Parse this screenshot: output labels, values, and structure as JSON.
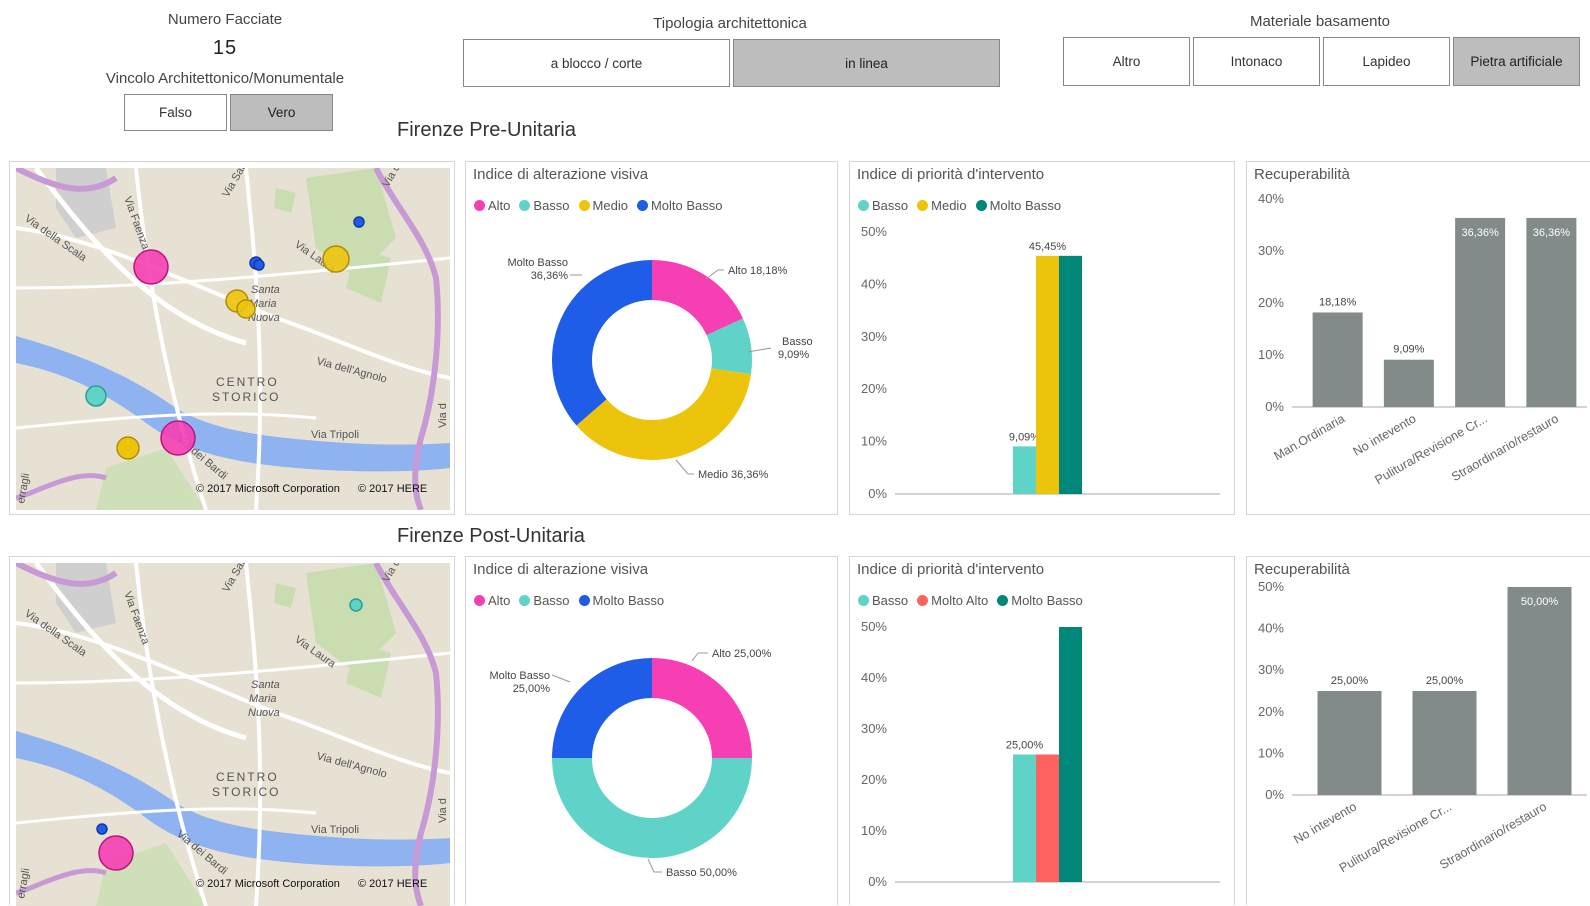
{
  "slicers": {
    "numero_facciate": {
      "title": "Numero Facciate",
      "value": "15"
    },
    "vincolo": {
      "title": "Vincolo Architettonico/Monumentale",
      "options": [
        "Falso",
        "Vero"
      ],
      "selected": "Vero"
    },
    "tipologia": {
      "title": "Tipologia architettonica",
      "options": [
        "a blocco / corte",
        "in linea"
      ],
      "selected": "in linea"
    },
    "materiale": {
      "title": "Materiale basamento",
      "options": [
        "Altro",
        "Intonaco",
        "Lapideo",
        "Pietra artificiale"
      ],
      "selected": "Pietra artificiale"
    }
  },
  "colors": {
    "Alto": "#f53fb3",
    "Basso": "#5fd3c8",
    "Medio": "#edc40c",
    "Molto Basso": "#1f5ce8",
    "Molto Alto": "#fd625e",
    "Molto Basso Priority": "#01877a",
    "gray": "#828b8a"
  },
  "sections": [
    {
      "title": "Firenze Pre-Unitaria",
      "map": {
        "labels": [
          "Via della Scala",
          "Via Faenza",
          "Via San",
          "Via d",
          "Via Laura",
          "Santa",
          "Maria",
          "Nuova",
          "CENTRO",
          "STORICO",
          "Via dell'Agnolo",
          "Via Tripoli",
          "Via dei Bardi",
          "erragli",
          "Via d"
        ],
        "copyright": [
          "© 2017 Microsoft Corporation",
          "© 2017 HERE"
        ]
      },
      "alterazione": {
        "title": "Indice di alterazione visiva",
        "legend": [
          "Alto",
          "Basso",
          "Medio",
          "Molto Basso"
        ],
        "chart_data": {
          "type": "pie",
          "categories": [
            "Alto",
            "Basso",
            "Medio",
            "Molto Basso"
          ],
          "values": [
            18.18,
            9.09,
            36.36,
            36.36
          ],
          "labels": [
            "Alto 18,18%",
            "Basso 9,09%",
            "Medio 36,36%",
            "Molto Basso 36,36%"
          ]
        }
      },
      "priorita": {
        "title": "Indice di priorità d'intervento",
        "legend": [
          "Basso",
          "Medio",
          "Molto Basso"
        ],
        "chart_data": {
          "type": "bar",
          "series": [
            {
              "name": "Basso",
              "values": [
                9.09
              ],
              "label": "9,09%"
            },
            {
              "name": "Medio",
              "values": [
                45.45
              ],
              "label": "45,45%"
            },
            {
              "name": "Molto Basso",
              "values": [
                45.45
              ],
              "label": ""
            }
          ],
          "ylim": [
            0,
            50
          ],
          "yticks": [
            "0%",
            "10%",
            "20%",
            "30%",
            "40%",
            "50%"
          ]
        }
      },
      "recuperabilita": {
        "title": "Recuperabilità",
        "chart_data": {
          "type": "bar",
          "categories": [
            "Man.Ordinaria",
            "No intevento",
            "Pulitura/Revisione Cr...",
            "Straordinario/restauro"
          ],
          "values": [
            18.18,
            9.09,
            36.36,
            36.36
          ],
          "labels": [
            "18,18%",
            "9,09%",
            "36,36%",
            "36,36%"
          ],
          "ylim": [
            0,
            40
          ],
          "yticks": [
            "0%",
            "10%",
            "20%",
            "30%",
            "40%"
          ]
        }
      }
    },
    {
      "title": "Firenze Post-Unitaria",
      "map": {
        "labels": [
          "Via della Scala",
          "Via Faenza",
          "Via San",
          "Via deg",
          "Via Laura",
          "Santa",
          "Maria",
          "Nuova",
          "CENTRO",
          "STORICO",
          "Via dell'Agnolo",
          "Via Tripoli",
          "Via dei Bardi",
          "erragli",
          "Via d"
        ],
        "copyright": [
          "© 2017 Microsoft Corporation",
          "© 2017 HERE"
        ]
      },
      "alterazione": {
        "title": "Indice di alterazione visiva",
        "legend": [
          "Alto",
          "Basso",
          "Molto Basso"
        ],
        "chart_data": {
          "type": "pie",
          "categories": [
            "Alto",
            "Basso",
            "Molto Basso"
          ],
          "values": [
            25.0,
            50.0,
            25.0
          ],
          "labels": [
            "Alto 25,00%",
            "Basso 50,00%",
            "Molto Basso 25,00%"
          ]
        }
      },
      "priorita": {
        "title": "Indice di priorità d'intervento",
        "legend": [
          "Basso",
          "Molto Alto",
          "Molto Basso"
        ],
        "chart_data": {
          "type": "bar",
          "series": [
            {
              "name": "Basso",
              "values": [
                25.0
              ],
              "label": "25,00%"
            },
            {
              "name": "Molto Alto",
              "values": [
                25.0
              ],
              "label": ""
            },
            {
              "name": "Molto Basso",
              "values": [
                50.0
              ],
              "label": ""
            }
          ],
          "ylim": [
            0,
            50
          ],
          "yticks": [
            "0%",
            "10%",
            "20%",
            "30%",
            "40%",
            "50%"
          ]
        }
      },
      "recuperabilita": {
        "title": "Recuperabilità",
        "chart_data": {
          "type": "bar",
          "categories": [
            "No intevento",
            "Pulitura/Revisione Cr...",
            "Straordinario/restauro"
          ],
          "values": [
            25.0,
            25.0,
            50.0
          ],
          "labels": [
            "25,00%",
            "25,00%",
            "50,00%"
          ],
          "ylim": [
            0,
            50
          ],
          "yticks": [
            "0%",
            "10%",
            "20%",
            "30%",
            "40%",
            "50%"
          ]
        }
      }
    }
  ]
}
